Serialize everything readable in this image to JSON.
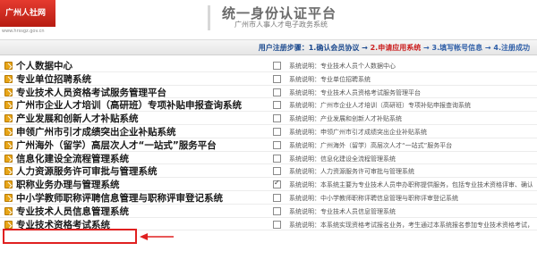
{
  "header": {
    "logo_text": "广州人社网",
    "logo_url": "www.hrssgz.gov.cn",
    "title": "统一身份认证平台",
    "subtitle": "广州市人事人才电子政务系统"
  },
  "steps": {
    "label": "用户注册步骤：",
    "step1": "1.确认会员协议",
    "step2": "2.申请应用系统",
    "step3": "3.填写帐号信息",
    "step4": "4.注册成功",
    "sep": " → "
  },
  "rows": [
    {
      "name": "个人数据中心",
      "desc": "系统说明：专业技术人员个人数据中心",
      "checked": false
    },
    {
      "name": "专业单位招聘系统",
      "desc": "系统说明：专业单位招聘系统",
      "checked": false
    },
    {
      "name": "专业技术人员资格考试服务管理平台",
      "desc": "系统说明：专业技术人员资格考试服务管理平台",
      "checked": false
    },
    {
      "name": "广州市企业人才培训（高研班）专项补贴申报查询系统",
      "desc": "系统说明：广州市企业人才培训（高研班）专项补贴申报查询系统",
      "checked": false
    },
    {
      "name": "产业发展和创新人才补贴系统",
      "desc": "系统说明：产业发展和创新人才补贴系统",
      "checked": false
    },
    {
      "name": "申领广州市引才成绩突出企业补贴系统",
      "desc": "系统说明：申领广州市引才成绩突出企业补贴系统",
      "checked": false
    },
    {
      "name": "广州海外（留学）高层次人才“一站式”服务平台",
      "desc": "系统说明：广州海外（留学）高层次人才“一站式”服务平台",
      "checked": false
    },
    {
      "name": "信息化建设全流程管理系统",
      "desc": "系统说明：信息化建设全流程管理系统",
      "checked": false
    },
    {
      "name": "人力资源服务许可审批与管理系统",
      "desc": "系统说明：人力资源服务许可审批与管理系统",
      "checked": false
    },
    {
      "name": "职称业务办理与管理系统",
      "desc": "系统说明：本系统主要为专业技术人员申办职称提供服务，包括专业技术资格评审、确认、认定、初定，以及聘任和申报后续管理等事项",
      "checked": true
    },
    {
      "name": "中小学教师职称评聘信息管理与职称评审登记系统",
      "desc": "系统说明：中小学教师职称评聘信息管理与职称评审登记系统",
      "checked": false
    },
    {
      "name": "专业技术人员信息管理系统",
      "desc": "系统说明：专业技术人员信息管理系统",
      "checked": false
    },
    {
      "name": "专业技术资格考试系统",
      "desc": "系统说明：本系统实现资格考试报名业务，考生通过本系统报名参加专业技术资格考试，包括报名、缴费、打印准考证等功能",
      "checked": false
    }
  ],
  "colors": {
    "accent": "#cc1f1f",
    "link_blue": "#1c4a8f",
    "icon_orange": "#e8a516",
    "highlight": "#e02020"
  }
}
